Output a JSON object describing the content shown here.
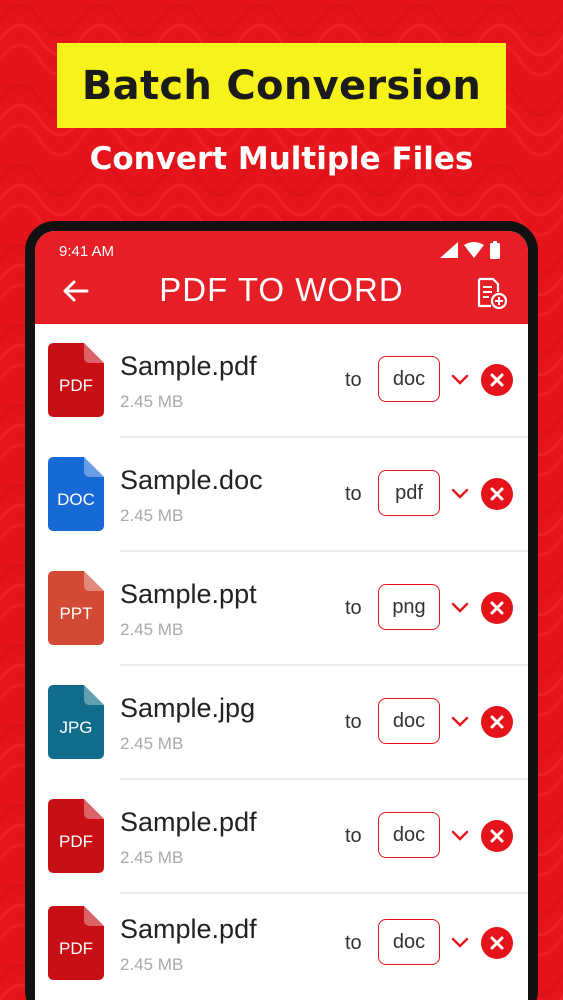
{
  "promo": {
    "headline": "Batch Conversion",
    "subheadline": "Convert Multiple Files"
  },
  "status_bar": {
    "time": "9:41 AM",
    "icons": [
      "signal-icon",
      "wifi-icon",
      "battery-icon"
    ]
  },
  "app_bar": {
    "title": "PDF TO WORD",
    "back_icon": "back-arrow-icon",
    "action_icon": "add-file-icon"
  },
  "colors": {
    "brand_red": "#e5141b",
    "banner_yellow": "#f6f21a",
    "pdf_red": "#c80f16",
    "doc_blue": "#1769d6",
    "ppt_orange": "#d24a34",
    "jpg_teal": "#106c8a"
  },
  "files": [
    {
      "name": "Sample.pdf",
      "size": "2.45 MB",
      "icon_label": "PDF",
      "to_label": "to",
      "target_format": "doc",
      "icon_color": "#c80f16"
    },
    {
      "name": "Sample.doc",
      "size": "2.45 MB",
      "icon_label": "DOC",
      "to_label": "to",
      "target_format": "pdf",
      "icon_color": "#1769d6"
    },
    {
      "name": "Sample.ppt",
      "size": "2.45 MB",
      "icon_label": "PPT",
      "to_label": "to",
      "target_format": "png",
      "icon_color": "#d24a34"
    },
    {
      "name": "Sample.jpg",
      "size": "2.45 MB",
      "icon_label": "JPG",
      "to_label": "to",
      "target_format": "doc",
      "icon_color": "#106c8a"
    },
    {
      "name": "Sample.pdf",
      "size": "2.45 MB",
      "icon_label": "PDF",
      "to_label": "to",
      "target_format": "doc",
      "icon_color": "#c80f16"
    },
    {
      "name": "Sample.pdf",
      "size": "2.45 MB",
      "icon_label": "PDF",
      "to_label": "to",
      "target_format": "doc",
      "icon_color": "#c80f16"
    }
  ]
}
